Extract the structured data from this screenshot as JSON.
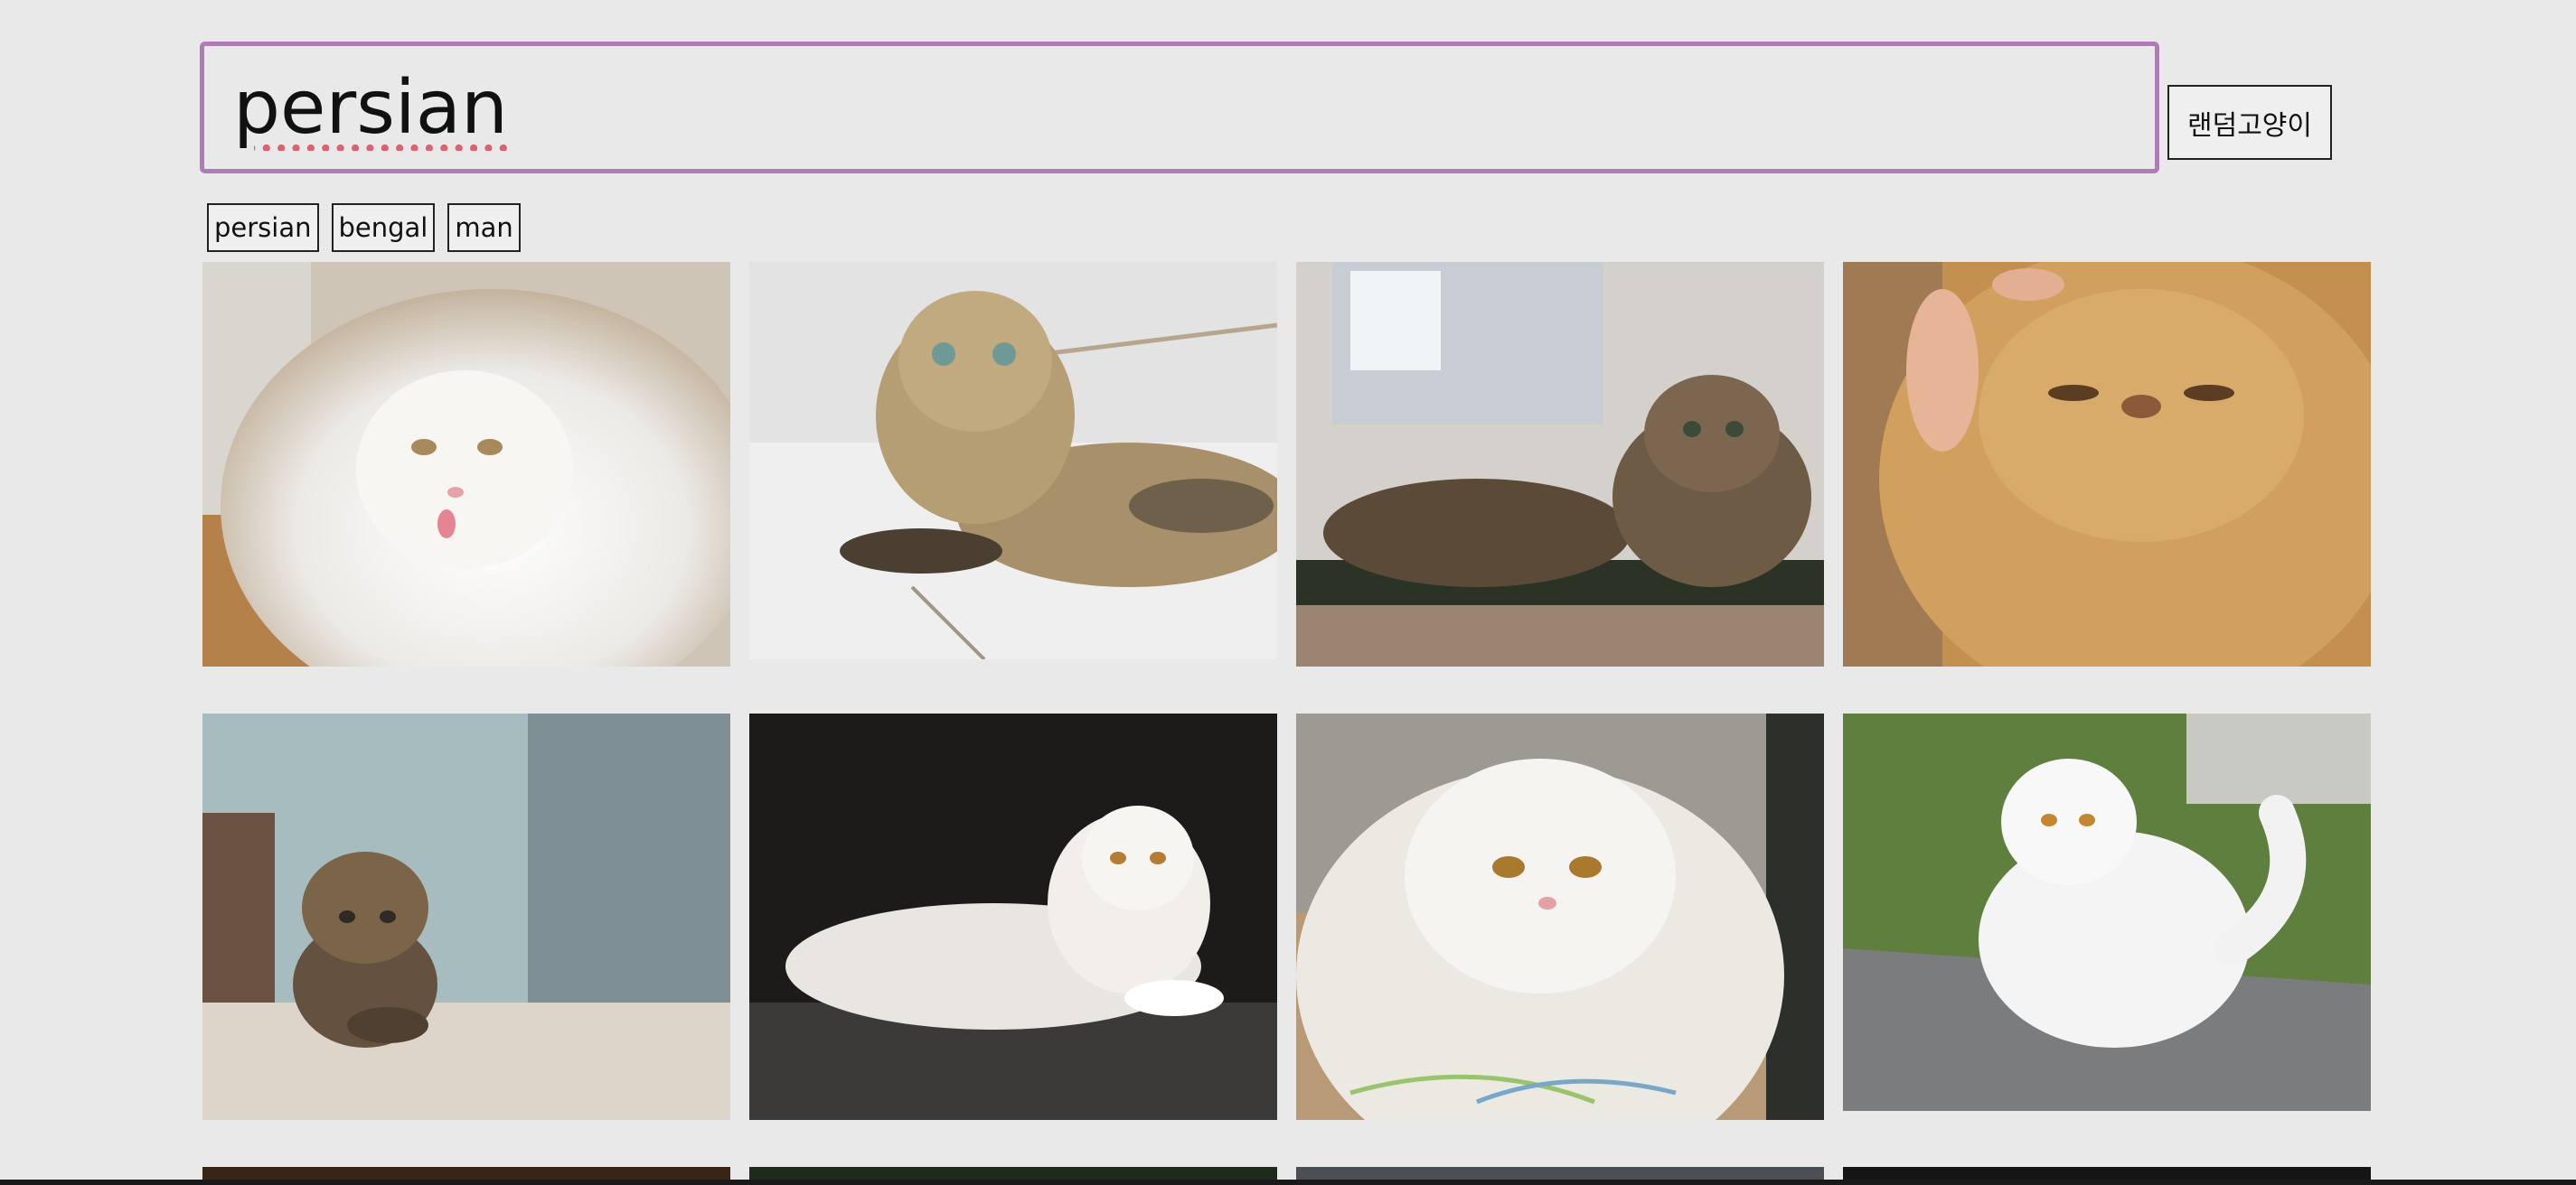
{
  "search": {
    "value": "persian",
    "random_button_label": "랜덤고양이"
  },
  "recent_keywords": [
    "persian",
    "bengal",
    "man"
  ],
  "results": [
    {
      "alt": "white persian cat licking lips"
    },
    {
      "alt": "golden chinchilla persian lying on tiles"
    },
    {
      "alt": "brown persian kitten on mat"
    },
    {
      "alt": "ginger persian face being petted"
    },
    {
      "alt": "tabby persian kitten on sofa"
    },
    {
      "alt": "white persian lying on dark cushion"
    },
    {
      "alt": "white persian close-up"
    },
    {
      "alt": "white persian walking on grass"
    },
    {
      "alt": "cat photo"
    },
    {
      "alt": "cat photo"
    },
    {
      "alt": "cat photo"
    },
    {
      "alt": "cat photo"
    }
  ]
}
